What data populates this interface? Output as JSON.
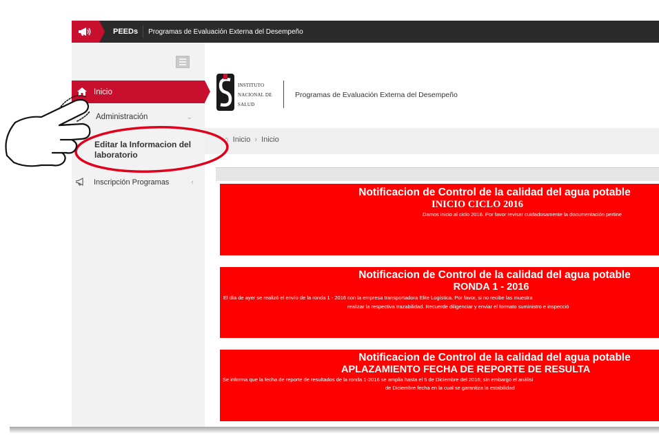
{
  "topbar": {
    "logo_icon": "megaphone-icon",
    "brand": "PEEDs",
    "subtitle": "Programas de Evaluación Externa del Desempeño"
  },
  "sidebar": {
    "toggle_icon": "menu-icon",
    "items": [
      {
        "label": "Inicio",
        "icon": "home-icon",
        "active": true
      },
      {
        "label": "Administración",
        "icon": "megaphone-icon"
      },
      {
        "label": "Editar la Informacion del laboratorio"
      },
      {
        "label": "Inscripción Programas",
        "icon": "megaphone-icon"
      }
    ]
  },
  "header": {
    "institute_line1": "INSTITUTO",
    "institute_line2": "NACIONAL DE",
    "institute_line3": "SALUD",
    "title": "Programas de Evaluación Externa del Desempeño"
  },
  "breadcrumb": {
    "items": [
      "Inicio",
      "Inicio"
    ]
  },
  "cards": [
    {
      "title": "Notificacion de Control de la calidad del agua potable",
      "subtitle": "INICIO CICLO 2016",
      "body": [
        "Damos inicio al ciclo 2016. Por favor revisar cuidadosamente la documentación pertine"
      ]
    },
    {
      "title": "Notificacion de Control de la calidad del agua potable",
      "subtitle": "RONDA 1 - 2016",
      "body": [
        "El día de ayer se realizó el envío de la ronda 1 - 2016 con la empresa transportadora Elite Logística. Por favor, si no recibe las muestra",
        "realizar la respectiva trazabilidad. Recuerde diligenciar y enviar el formato suministro e inspecció"
      ]
    },
    {
      "title": "Notificacion de Control de la calidad del agua potable",
      "subtitle": "APLAZAMIENTO FECHA DE REPORTE DE RESULTA",
      "body": [
        "Se informa que la fecha de reporte de resultados de la ronda 1-2016 se amplia hasta el 5 de Diciembre del 2016; sin embargo el análisi",
        "de Diciembre fecha en la cual se garantiza la estabilidad"
      ]
    }
  ],
  "colors": {
    "accent": "#c8102e",
    "card_red": "#ff0000",
    "topbar": "#2b2b2b",
    "annotation": "#e0001b"
  }
}
